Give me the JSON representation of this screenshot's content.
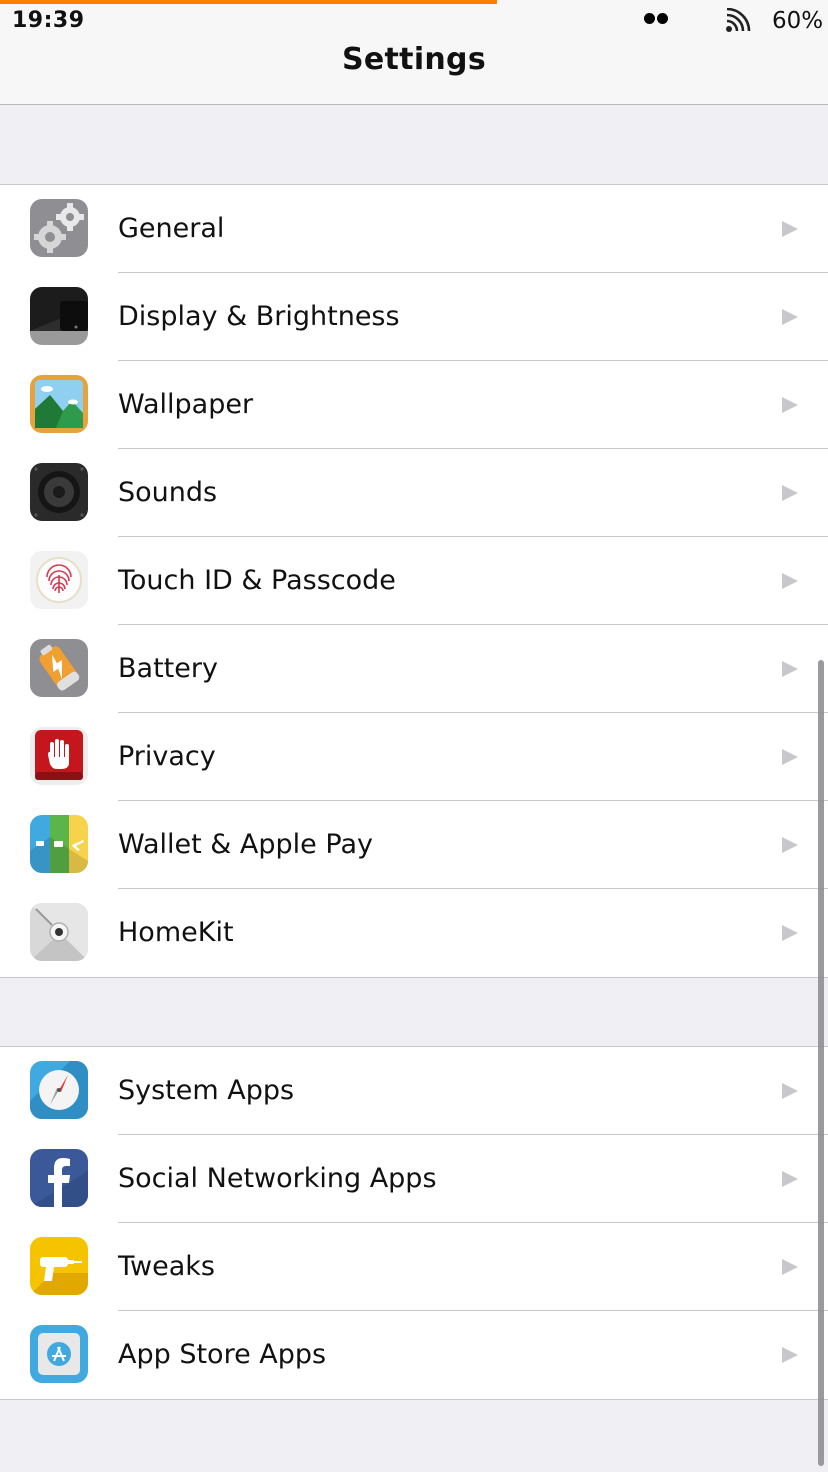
{
  "status_bar": {
    "time": "19:39",
    "battery": "60%",
    "progress_fraction": 0.6,
    "accent_color": "#ff7e00"
  },
  "nav": {
    "title": "Settings"
  },
  "groups": [
    {
      "items": [
        {
          "label": "General",
          "icon": "gears-icon"
        },
        {
          "label": "Display & Brightness",
          "icon": "display-icon"
        },
        {
          "label": "Wallpaper",
          "icon": "mountain-picture-icon"
        },
        {
          "label": "Sounds",
          "icon": "speaker-icon"
        },
        {
          "label": "Touch ID & Passcode",
          "icon": "fingerprint-icon"
        },
        {
          "label": "Battery",
          "icon": "battery-bolt-icon"
        },
        {
          "label": "Privacy",
          "icon": "hand-icon"
        },
        {
          "label": "Wallet & Apple Pay",
          "icon": "wallet-icon"
        },
        {
          "label": "HomeKit",
          "icon": "home-dial-icon"
        }
      ]
    },
    {
      "items": [
        {
          "label": "System Apps",
          "icon": "compass-icon"
        },
        {
          "label": "Social Networking Apps",
          "icon": "facebook-icon"
        },
        {
          "label": "Tweaks",
          "icon": "drill-icon"
        },
        {
          "label": "App Store Apps",
          "icon": "app-store-icon"
        }
      ]
    }
  ]
}
